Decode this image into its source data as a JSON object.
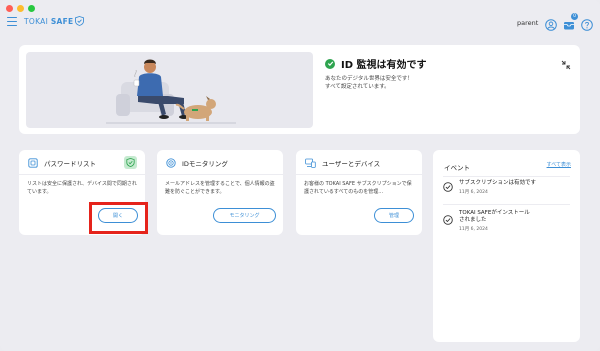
{
  "header": {
    "logo_prefix": "TOKAI",
    "logo_suffix": "SAFE",
    "user_name": "parent",
    "notification_count": "0"
  },
  "hero": {
    "title": "ID 監視は有効です",
    "desc_line1": "あなたのデジタル世界は安全です！",
    "desc_line2": "すべて設定されています。"
  },
  "cards": {
    "password": {
      "title": "パスワードリスト",
      "text": "リストは安全に保護され、デバイス間で同期されています。",
      "button": "開く"
    },
    "id_monitoring": {
      "title": "IDモニタリング",
      "text": "メールアドレスを管理することで、個人情報の盗難を防ぐことができます。",
      "button": "モニタリング"
    },
    "users": {
      "title": "ユーザーとデバイス",
      "text": "お客様の TOKAI SAFE サブスクリプションで保護されているすべてのものを管理...",
      "button": "管理"
    }
  },
  "events": {
    "title": "イベント",
    "view_all": "すべて表示",
    "items": [
      {
        "title": "サブスクリプションは有効です",
        "date": "11月 6, 2024"
      },
      {
        "title_line1": "TOKAI SAFEがインストール",
        "title_line2": "されました",
        "date": "11月 6, 2024"
      }
    ]
  },
  "colors": {
    "accent": "#3d8fd6",
    "success": "#2ea44f",
    "highlight": "#e5231b"
  }
}
